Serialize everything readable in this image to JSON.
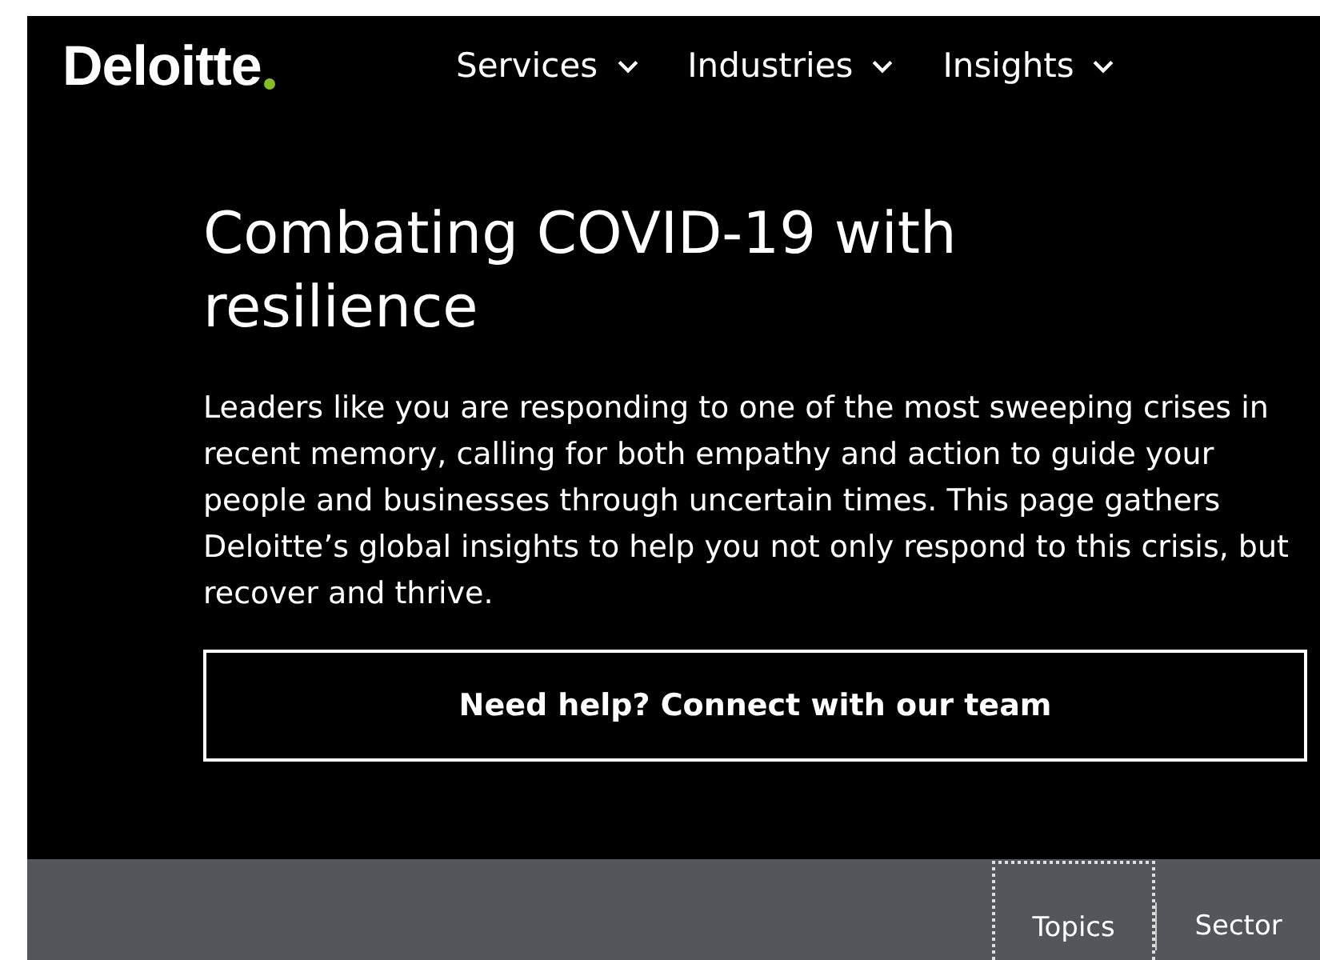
{
  "header": {
    "logo": "Deloitte",
    "nav": [
      {
        "label": "Services"
      },
      {
        "label": "Industries"
      },
      {
        "label": "Insights"
      }
    ]
  },
  "hero": {
    "title": "Combating COVID-19 with resilience",
    "text": "Leaders like you are responding to one of the most sweeping crises in recent memory, calling for both empathy and action to guide your people and businesses through uncertain times. This page gathers Deloitte’s global insights to help you not only respond to this crisis, but recover and thrive.",
    "button": "Need help? Connect with our team"
  },
  "tabs": [
    {
      "label": "Topics",
      "selected": true
    },
    {
      "label": "Sector",
      "selected": false
    }
  ]
}
